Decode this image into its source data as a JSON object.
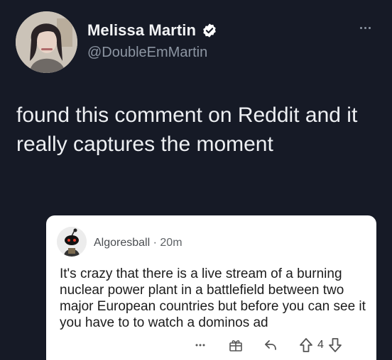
{
  "author": {
    "display_name": "Melissa Martin",
    "handle": "@DoubleEmMartin",
    "verified": true
  },
  "tweet": {
    "text": "found this comment on Reddit and it really captures the moment"
  },
  "reddit_comment": {
    "username": "Algoresball",
    "separator": "·",
    "time": "20m",
    "body": "It's crazy that there is a live stream of a burning nuclear power plant in a battlefield between two major European countries but before you can see it you have to to watch a dominos ad",
    "score": "4"
  },
  "icons": {
    "more": "more-horizontal-icon",
    "verified": "verified-badge-icon",
    "award": "gift-award-icon",
    "reply": "reply-arrow-icon",
    "upvote": "upvote-arrow-icon",
    "downvote": "downvote-arrow-icon"
  },
  "colors": {
    "background": "#161a26",
    "verified_badge": "#ffffff",
    "card": "#ffffff"
  }
}
